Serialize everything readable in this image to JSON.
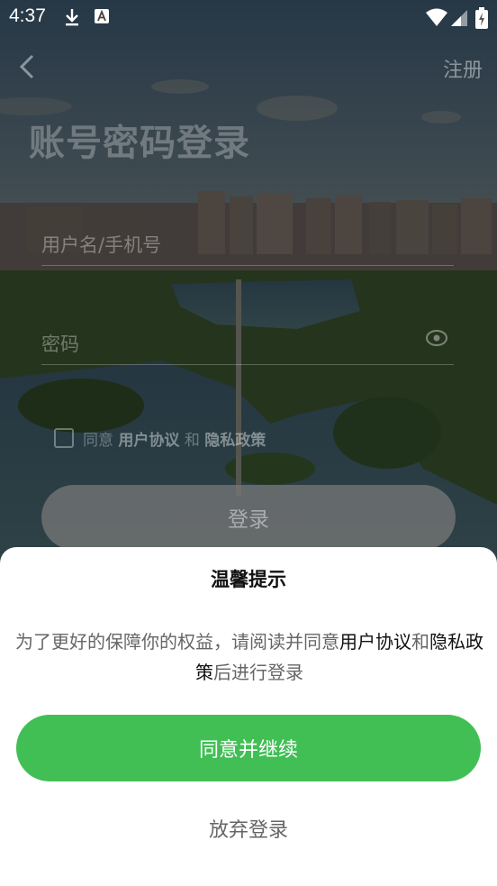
{
  "status_bar": {
    "time": "4:37"
  },
  "nav": {
    "register_label": "注册"
  },
  "page_title": "账号密码登录",
  "form": {
    "username_placeholder": "用户名/手机号",
    "password_placeholder": "密码"
  },
  "agreement": {
    "prefix": "同意",
    "user_agreement": "用户协议",
    "and": "和",
    "privacy_policy": "隐私政策"
  },
  "login_label": "登录",
  "dialog": {
    "title": "温馨提示",
    "body_prefix": "为了更好的保障你的权益，请阅读并同意",
    "user_agreement": "用户协议",
    "and": "和",
    "privacy_policy": "隐私政策",
    "body_suffix": "后进行登录",
    "continue_label": "同意并继续",
    "cancel_label": "放弃登录"
  },
  "colors": {
    "accent": "#41bf55"
  }
}
